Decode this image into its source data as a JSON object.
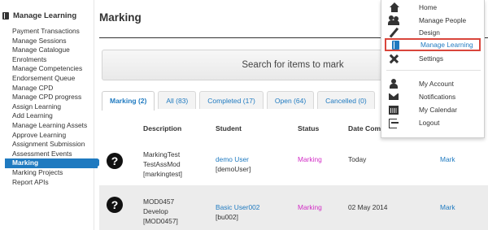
{
  "sidebar": {
    "title": "Manage Learning",
    "items": [
      "Payment Transactions",
      "Manage Sessions",
      "Manage Catalogue",
      "Enrolments",
      "Manage Competencies",
      "Endorsement Queue",
      "Manage CPD",
      "Manage CPD progress",
      "Assign Learning",
      "Add Learning",
      "Manage Learning Assets",
      "Approve Learning",
      "Assignment Submission",
      "Assessment Events",
      "Marking",
      "Marking Projects",
      "Report APIs"
    ],
    "active_item": "Marking"
  },
  "main": {
    "title": "Marking",
    "search_label": "Search for items to mark",
    "tabs": [
      {
        "label": "Marking (2)",
        "active": true
      },
      {
        "label": "All (83)",
        "active": false
      },
      {
        "label": "Completed (17)",
        "active": false
      },
      {
        "label": "Open (64)",
        "active": false
      },
      {
        "label": "Cancelled (0)",
        "active": false
      }
    ],
    "columns": {
      "description": "Description",
      "student": "Student",
      "status": "Status",
      "date": "Date Comp"
    },
    "rows": [
      {
        "icon": "question-icon",
        "description": [
          "MarkingTest",
          "TestAssMod",
          "[markingtest]"
        ],
        "student_name": "demo User",
        "student_id": "[demoUser]",
        "status": "Marking",
        "date": "Today",
        "action": "Mark"
      },
      {
        "icon": "question-icon",
        "description": [
          "MOD0457",
          "Develop",
          "[MOD0457]"
        ],
        "student_name": "Basic User002",
        "student_id": "[bu002]",
        "status": "Marking",
        "date": "02 May 2014",
        "action": "Mark"
      }
    ]
  },
  "dropdown": {
    "items": [
      {
        "label": "Home",
        "icon": "home-icon"
      },
      {
        "label": "Manage People",
        "icon": "people-icon"
      },
      {
        "label": "Design",
        "icon": "pencil-icon"
      },
      {
        "label": "Manage Learning",
        "icon": "book-icon",
        "highlighted": true
      },
      {
        "label": "Settings",
        "icon": "tools-icon"
      },
      {
        "label": "My Account",
        "icon": "user-icon"
      },
      {
        "label": "Notifications",
        "icon": "envelope-icon"
      },
      {
        "label": "My Calendar",
        "icon": "calendar-icon"
      },
      {
        "label": "Logout",
        "icon": "logout-icon"
      }
    ]
  },
  "colors": {
    "accent": "#1f7ac0",
    "status_marking": "#d22ec6",
    "highlight_border": "#d9463c"
  }
}
